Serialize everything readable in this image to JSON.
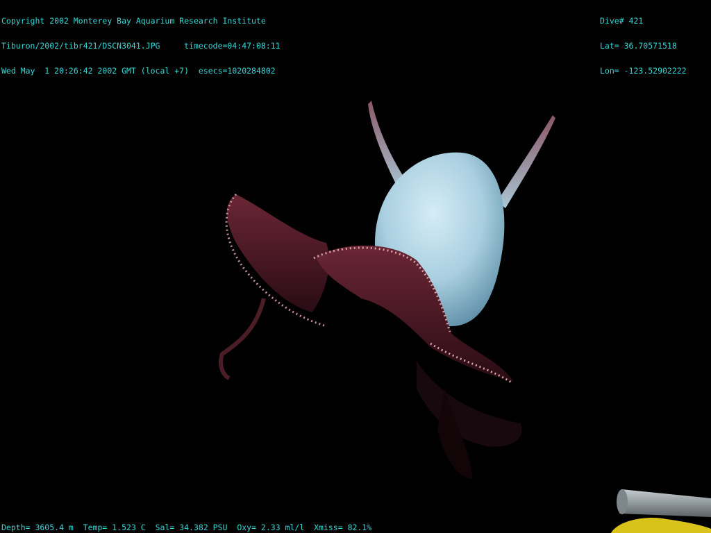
{
  "overlay": {
    "copyright": "Copyright 2002 Monterey Bay Aquarium Research Institute",
    "file_path": "Tiburon/2002/tibr421/DSCN3041.JPG",
    "timecode": "timecode=04:47:08:11",
    "datetime": "Wed May  1 20:26:42 2002 GMT (local +7)",
    "esecs": "esecs=1020284802",
    "dive": "Dive# 421",
    "lat": "Lat= 36.70571518",
    "lon": "Lon= -123.52902222",
    "depth": "Depth= 3605.4 m",
    "temp": "Temp= 1.523 C",
    "sal": "Sal= 34.382 PSU",
    "oxy": "Oxy= 2.33 ml/l",
    "xmiss": "Xmiss= 82.1%"
  },
  "colors": {
    "background": "#000000",
    "overlay_text": "#35d7d7",
    "body": "#b9d9e6",
    "web": "#5a1f2c",
    "suckers": "#d4a3a8",
    "pipe": "#9aa3a7",
    "sponge": "#d9c21a"
  }
}
